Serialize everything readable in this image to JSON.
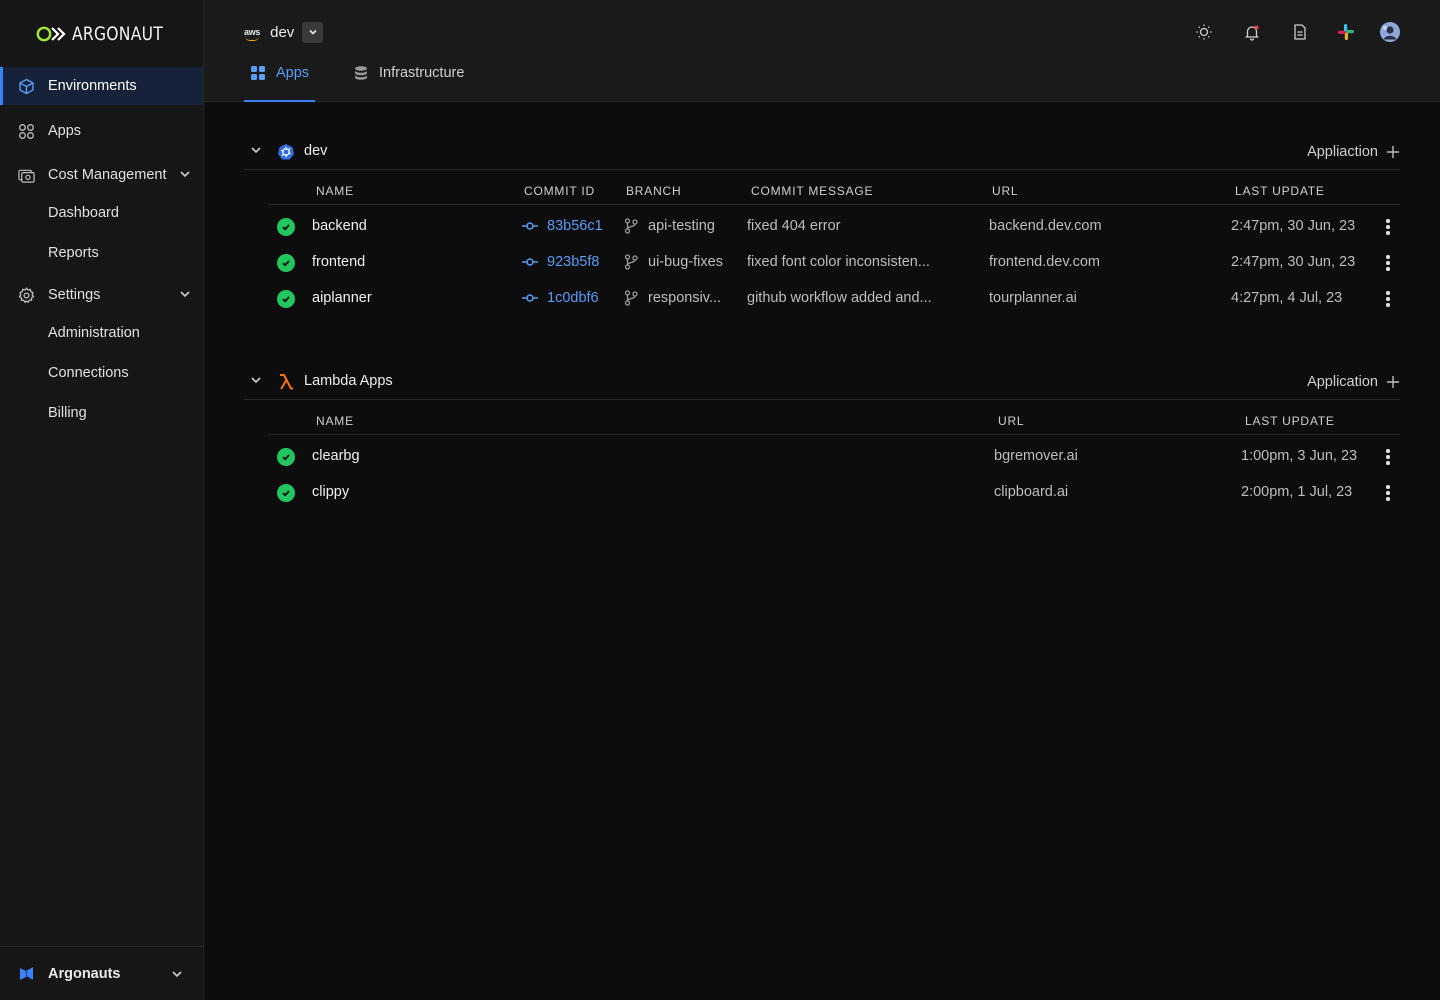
{
  "brand": {
    "name": "ARGONAUT",
    "accent": "#3b82f6",
    "success": "#22c55e"
  },
  "sidebar": {
    "items": [
      {
        "label": "Environments",
        "icon": "cube-icon"
      },
      {
        "label": "Apps",
        "icon": "grid-icon"
      },
      {
        "label": "Cost Management",
        "icon": "cost-icon"
      },
      {
        "label": "Dashboard"
      },
      {
        "label": "Reports"
      },
      {
        "label": "Settings",
        "icon": "gear-icon"
      },
      {
        "label": "Administration"
      },
      {
        "label": "Connections"
      },
      {
        "label": "Billing"
      }
    ],
    "org": "Argonauts"
  },
  "header": {
    "provider": "aws",
    "env": "dev",
    "tabs": [
      {
        "label": "Apps"
      },
      {
        "label": "Infrastructure"
      }
    ]
  },
  "sections": [
    {
      "title": "dev",
      "add_label": "Appliaction",
      "columns": [
        "NAME",
        "COMMIT ID",
        "BRANCH",
        "COMMIT MESSAGE",
        "URL",
        "LAST UPDATE"
      ],
      "rows": [
        {
          "name": "backend",
          "commit": "83b56c1",
          "branch": "api-testing",
          "message": "fixed 404 error",
          "url": "backend.dev.com",
          "updated": "2:47pm, 30 Jun, 23"
        },
        {
          "name": "frontend",
          "commit": "923b5f8",
          "branch": "ui-bug-fixes",
          "message": "fixed font color inconsisten...",
          "url": "frontend.dev.com",
          "updated": "2:47pm, 30 Jun, 23"
        },
        {
          "name": "aiplanner",
          "commit": "1c0dbf6",
          "branch": "responsiv...",
          "message": "github workflow added and...",
          "url": "tourplanner.ai",
          "updated": "4:27pm, 4 Jul, 23"
        }
      ]
    },
    {
      "title": "Lambda Apps",
      "add_label": "Application",
      "columns": [
        "NAME",
        "URL",
        "LAST UPDATE"
      ],
      "rows": [
        {
          "name": "clearbg",
          "url": "bgremover.ai",
          "updated": "1:00pm, 3 Jun, 23"
        },
        {
          "name": "clippy",
          "url": "clipboard.ai",
          "updated": "2:00pm, 1 Jul, 23"
        }
      ]
    }
  ]
}
